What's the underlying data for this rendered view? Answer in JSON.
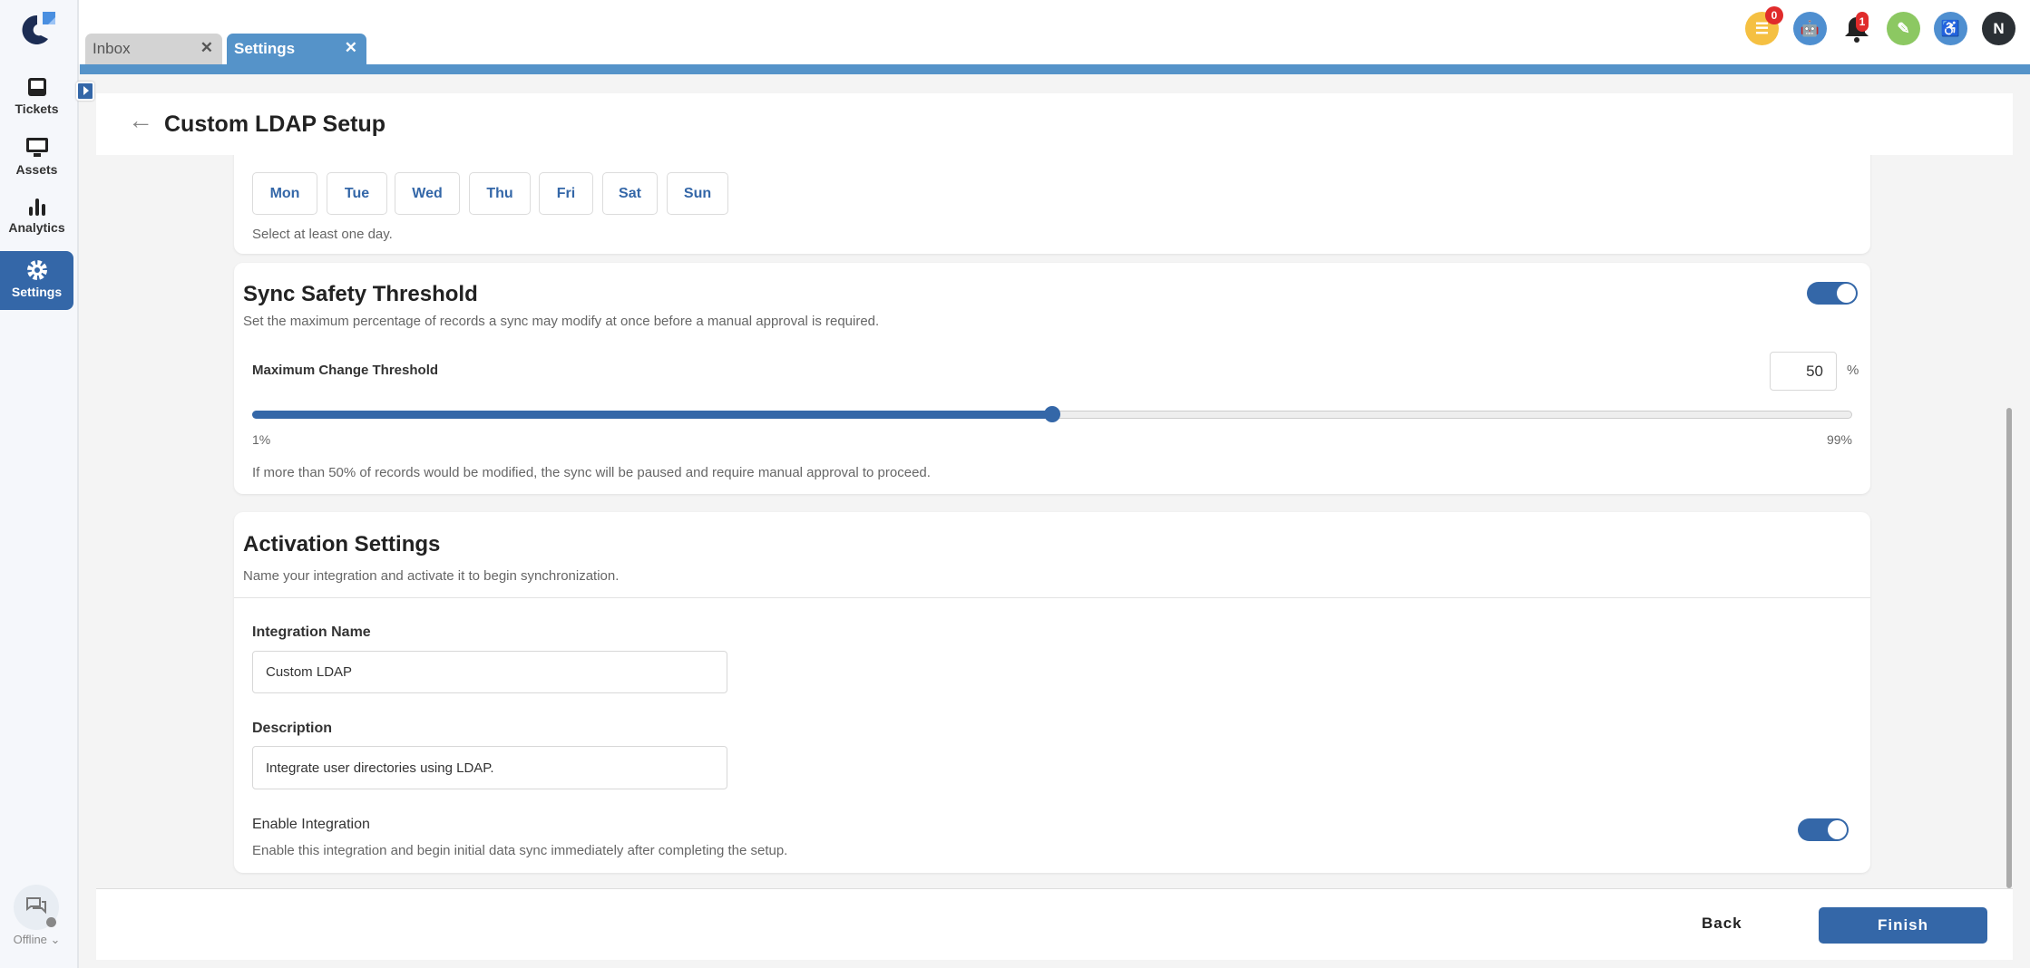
{
  "sidebar": {
    "items": [
      {
        "label": "Tickets"
      },
      {
        "label": "Assets"
      },
      {
        "label": "Analytics"
      },
      {
        "label": "Settings"
      }
    ],
    "status": "Offline ⌄"
  },
  "tabs": [
    {
      "label": "Inbox"
    },
    {
      "label": "Settings"
    }
  ],
  "top_icons": {
    "tasks_badge": "0",
    "notifications_badge": "1",
    "avatar_initial": "N"
  },
  "header": {
    "title": "Custom LDAP Setup"
  },
  "schedule": {
    "days": [
      "Mon",
      "Tue",
      "Wed",
      "Thu",
      "Fri",
      "Sat",
      "Sun"
    ],
    "hint": "Select at least one day."
  },
  "safety": {
    "title": "Sync Safety Threshold",
    "description": "Set the maximum percentage of records a sync may modify at once before a manual approval is required.",
    "enabled": true,
    "field_label": "Maximum Change Threshold",
    "value": "50",
    "unit": "%",
    "slider_value": 50,
    "min_label": "1%",
    "max_label": "99%",
    "note": "If more than 50% of records would be modified, the sync will be paused and require manual approval to proceed."
  },
  "activation": {
    "title": "Activation Settings",
    "description": "Name your integration and activate it to begin synchronization.",
    "name_label": "Integration Name",
    "name_value": "Custom LDAP",
    "desc_label": "Description",
    "desc_value": "Integrate user directories using LDAP.",
    "enable_label": "Enable Integration",
    "enable_desc": "Enable this integration and begin initial data sync immediately after completing the setup.",
    "enabled": true
  },
  "footer": {
    "back": "Back",
    "finish": "Finish"
  },
  "colors": {
    "primary": "#3467a8",
    "tab_bar": "#5593c9"
  }
}
